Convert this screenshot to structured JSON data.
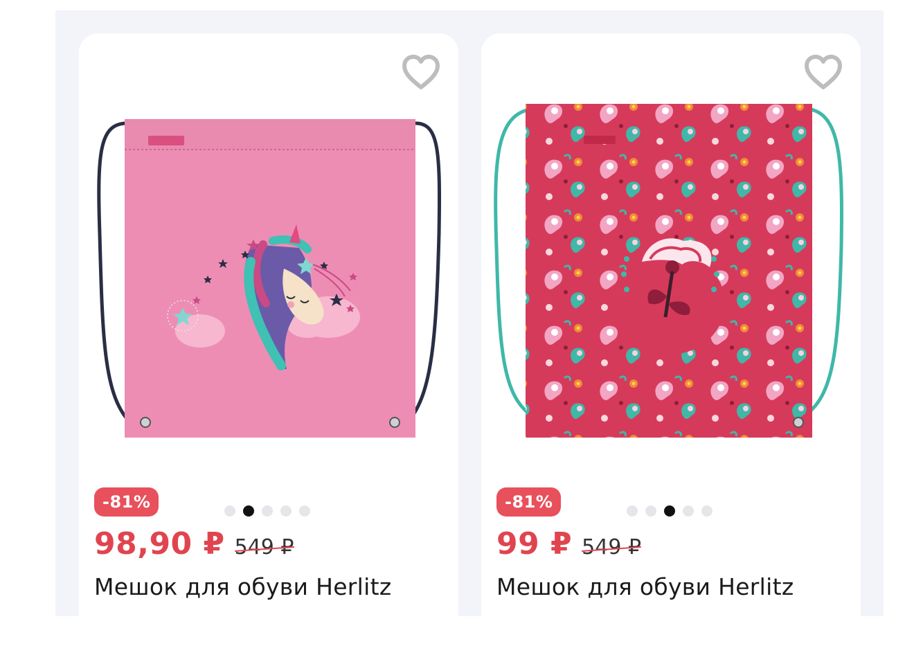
{
  "products": [
    {
      "image_icon": "pink-unicorn-drawstring-bag",
      "discount": "-81%",
      "price": "98,90 ₽",
      "old_price": "549 ₽",
      "title": "Мешок для обуви Herlitz",
      "dots_count": 5,
      "active_dot": 2,
      "colors": {
        "bag": "#ee8db4",
        "cord": "#2a2e45"
      }
    },
    {
      "image_icon": "red-paisley-drawstring-bag",
      "discount": "-81%",
      "price": "99 ₽",
      "old_price": "549 ₽",
      "title": "Мешок для обуви Herlitz",
      "dots_count": 5,
      "active_dot": 3,
      "colors": {
        "bag": "#d63a5a",
        "cord": "#3fb8a8"
      }
    }
  ],
  "colors": {
    "discount_badge": "#e8505b",
    "price": "#e0454f",
    "favorite_icon": "#bdbdbd",
    "background": "#f2f4f9"
  }
}
